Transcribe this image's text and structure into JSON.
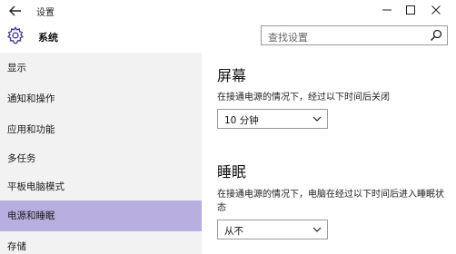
{
  "window": {
    "title": "设置",
    "back_icon": "arrow-left-icon",
    "controls": [
      "minimize-icon",
      "maximize-icon",
      "close-icon"
    ]
  },
  "header": {
    "icon": "gear-icon",
    "title": "系统",
    "search": {
      "placeholder": "查找设置",
      "icon": "search-icon"
    }
  },
  "sidebar": {
    "active_color": "#b9aee0",
    "items": [
      {
        "label": "显示"
      },
      {
        "label": "通知和操作"
      },
      {
        "label": "应用和功能"
      },
      {
        "label": "多任务"
      },
      {
        "label": "平板电脑模式"
      },
      {
        "label": "电源和睡眠",
        "active": true
      },
      {
        "label": "存储"
      }
    ]
  },
  "content": {
    "screen": {
      "title": "屏幕",
      "desc": "在接通电源的情况下，经过以下时间后关闭",
      "value": "10 分钟"
    },
    "sleep": {
      "title": "睡眠",
      "desc": "在接通电源的情况下，电脑在经过以下时间后进入睡眠状态",
      "value": "从不"
    }
  }
}
